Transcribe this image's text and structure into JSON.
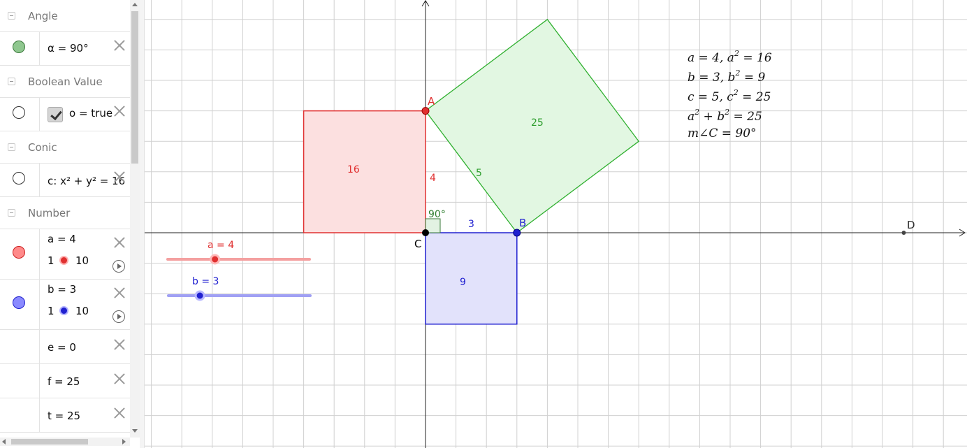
{
  "algebra_view": {
    "categories": {
      "angle": "Angle",
      "boolean": "Boolean Value",
      "conic": "Conic",
      "number": "Number"
    },
    "items": {
      "alpha": {
        "text": "α = 90°",
        "color": "#6aa86a"
      },
      "o": {
        "text": "o = true"
      },
      "c": {
        "text": "c: x² + y² = 16"
      },
      "a": {
        "text": "a = 4",
        "min": "1",
        "max": "10",
        "value": 4,
        "color": "#ff7777"
      },
      "b": {
        "text": "b = 3",
        "min": "1",
        "max": "10",
        "value": 3,
        "color": "#7777ff"
      },
      "e": {
        "text": "e = 0"
      },
      "f": {
        "text": "f = 25"
      },
      "t": {
        "text": "t = 25"
      }
    }
  },
  "graphics": {
    "points": {
      "A": {
        "label": "A",
        "x": 0,
        "y": 4,
        "color": "#e03030"
      },
      "B": {
        "label": "B",
        "x": 3,
        "y": 0,
        "color": "#2020d0"
      },
      "C": {
        "label": "C",
        "x": 0,
        "y": 0,
        "color": "#000000"
      },
      "D": {
        "label": "D",
        "x": 15.7,
        "y": 0,
        "color": "#333333"
      }
    },
    "squares": {
      "a_square": {
        "area_label": "16",
        "side_label": "4",
        "stroke": "#e03030",
        "fill": "#fce0e0"
      },
      "b_square": {
        "area_label": "9",
        "side_label": "3",
        "stroke": "#2020d0",
        "fill": "#e2e2fb"
      },
      "c_square": {
        "area_label": "25",
        "side_label": "5",
        "stroke": "#30b030",
        "fill": "#e2f7e2"
      }
    },
    "angle_label": "90°",
    "sliders": {
      "a": {
        "label": "a = 4",
        "value": 4,
        "min": 1,
        "max": 10,
        "color": "#e03030",
        "track": "#f4a0a0"
      },
      "b": {
        "label": "b = 3",
        "value": 3,
        "min": 1,
        "max": 10,
        "color": "#2020d0",
        "track": "#a0a0f4"
      }
    },
    "annotations": {
      "line1": [
        "a = 4, a",
        "2",
        " = 16"
      ],
      "line2": [
        "b = 3, b",
        "2",
        " = 9"
      ],
      "line3": [
        "c = 5, c",
        "2",
        " = 25"
      ],
      "line4": [
        "a",
        "2",
        " + b",
        "2",
        " = 25"
      ],
      "line5": "m∠C = 90°"
    }
  }
}
